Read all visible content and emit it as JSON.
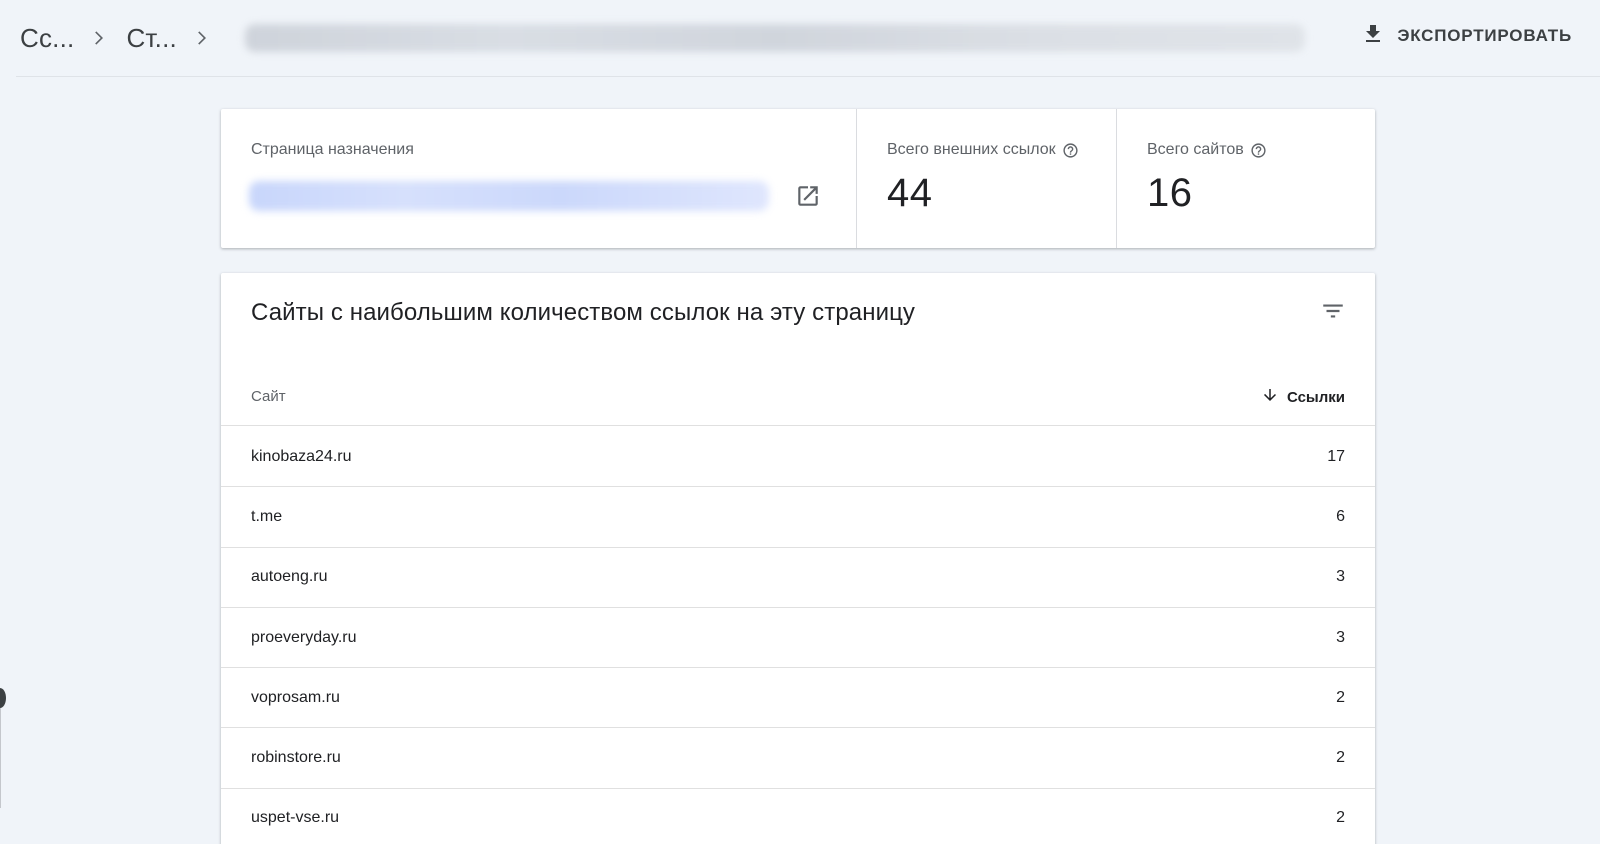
{
  "breadcrumb": {
    "item1": "Сс...",
    "item2": "Ст..."
  },
  "header": {
    "export_label": "ЭКСПОРТИРОВАТЬ"
  },
  "summary": {
    "destination_label": "Страница назначения",
    "external_links_label": "Всего внешних ссылок",
    "external_links_value": "44",
    "sites_label": "Всего сайтов",
    "sites_value": "16"
  },
  "table": {
    "title": "Сайты с наибольшим количеством ссылок на эту страницу",
    "col_site": "Сайт",
    "col_links": "Ссылки",
    "rows": [
      {
        "site": "kinobaza24.ru",
        "links": "17"
      },
      {
        "site": "t.me",
        "links": "6"
      },
      {
        "site": "autoeng.ru",
        "links": "3"
      },
      {
        "site": "proeveryday.ru",
        "links": "3"
      },
      {
        "site": "voprosam.ru",
        "links": "2"
      },
      {
        "site": "robinstore.ru",
        "links": "2"
      },
      {
        "site": "uspet-vse.ru",
        "links": "2"
      }
    ]
  },
  "icons": {
    "chevron": "chevron-right-icon",
    "export": "download-icon",
    "help": "help-circle-icon",
    "open": "open-in-new-icon",
    "filter": "filter-list-icon",
    "sort": "arrow-down-icon"
  },
  "colors": {
    "page_bg": "#f0f4f9",
    "card_bg": "#ffffff",
    "text_primary": "#202124",
    "text_secondary": "#5f6368"
  }
}
